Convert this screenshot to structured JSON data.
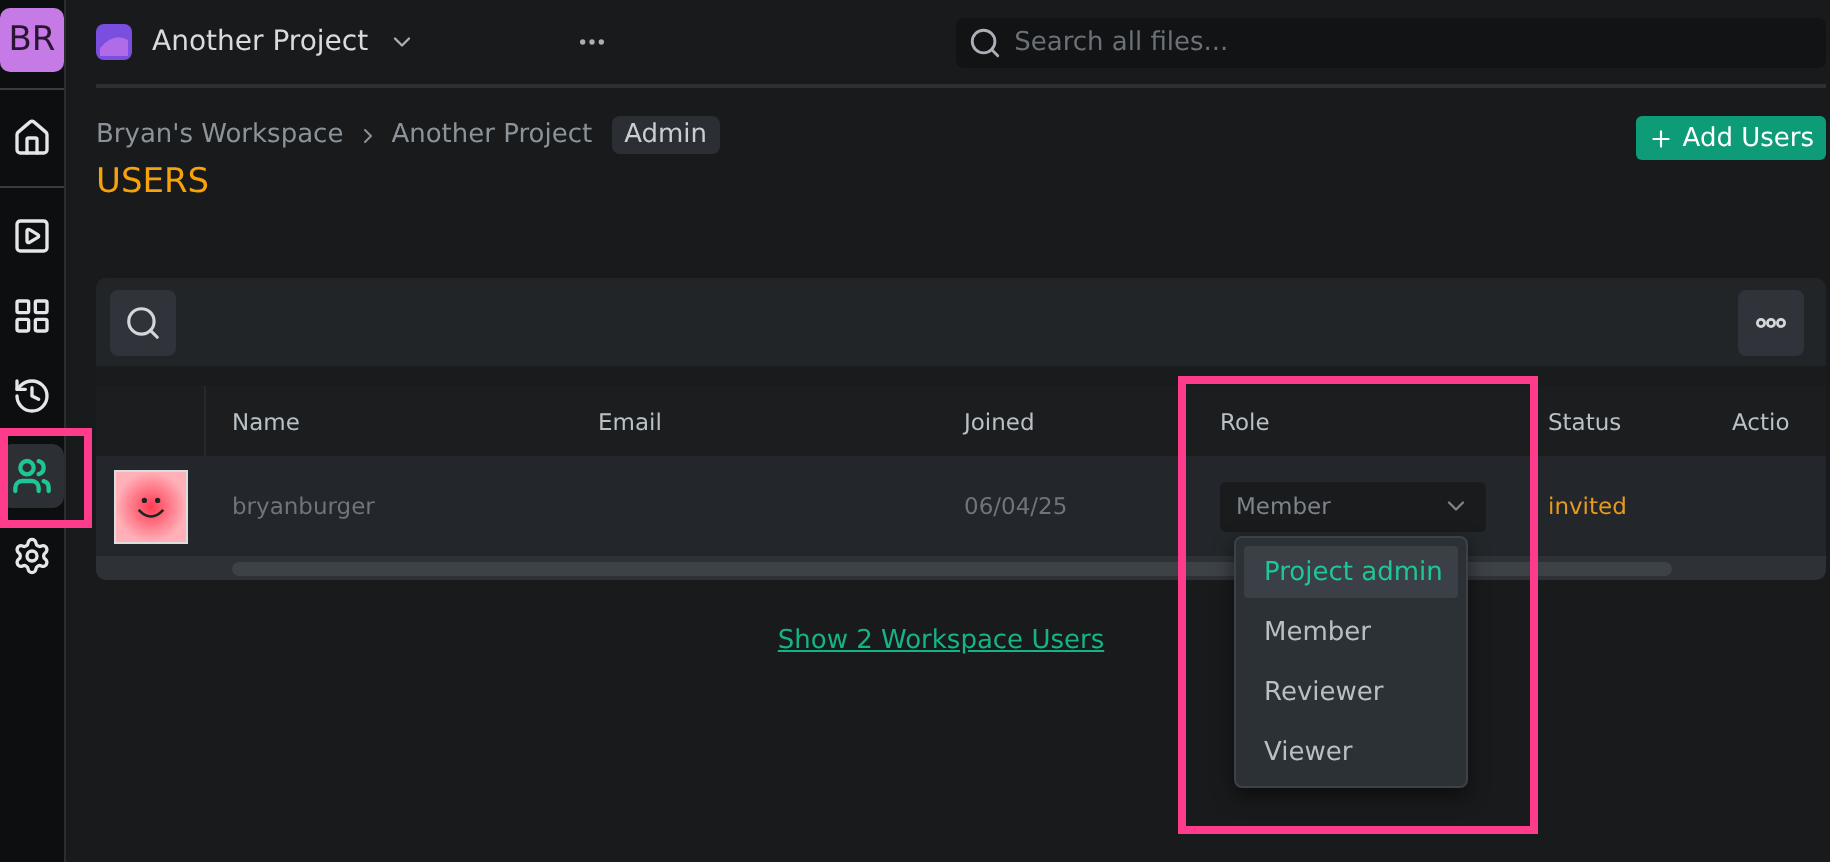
{
  "sidebar": {
    "avatar": "BR",
    "items": [
      {
        "kind": "home",
        "selected": false
      },
      {
        "kind": "play",
        "selected": false
      },
      {
        "kind": "grid",
        "selected": false
      },
      {
        "kind": "history",
        "selected": false
      },
      {
        "kind": "users",
        "selected": true
      },
      {
        "kind": "settings",
        "selected": false
      }
    ]
  },
  "header": {
    "project": "Another Project",
    "search": {
      "placeholder": "Search all files..."
    }
  },
  "breadcrumb": [
    "Bryan's Workspace",
    "Another Project"
  ],
  "badge": "Admin",
  "title": "USERS",
  "add_button": "Add Users",
  "table": {
    "columns": [
      "Name",
      "Email",
      "Joined",
      "Role",
      "Status",
      "Actio"
    ],
    "rows": [
      {
        "name": "bryanburger",
        "joined": "06/04/25",
        "role": "Member",
        "status": "invited"
      }
    ]
  },
  "role_menu": {
    "options": [
      {
        "label": "Project admin",
        "selected": true
      },
      {
        "label": "Member",
        "selected": false
      },
      {
        "label": "Reviewer",
        "selected": false
      },
      {
        "label": "Viewer",
        "selected": false
      }
    ]
  },
  "link": "Show 2 Workspace Users"
}
